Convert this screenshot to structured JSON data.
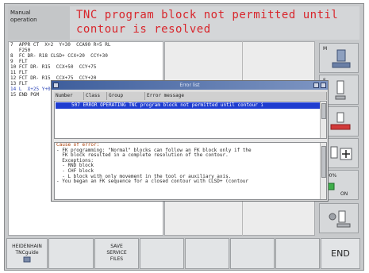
{
  "header": {
    "mode_label": [
      "Manual",
      "operation"
    ],
    "title_lines": [
      "TNC program block not permitted until",
      "contour is resolved"
    ]
  },
  "program": {
    "lines": [
      "7  APPR CT  X+2  Y+30  CCA90 R+5 RL",
      "   F250",
      "8  FC DR- R18 CLSD+ CCX+20  CCY+30",
      "9  FLT",
      "10 FCT DR- R15  CCX+50  CCY+75",
      "11 FLT",
      "12 FCT DR- R15  CCX+75  CCY+20",
      "13 FLT",
      "14 L  X+25 Y+0 R0 FMAX",
      "15 END PGM"
    ],
    "highlighted_index": 8
  },
  "error_dialog": {
    "title": "Error list",
    "columns": [
      "Number",
      "Class",
      "Group",
      "Error message"
    ],
    "selected_row": "507 ERROR OPERATING TNC program block not permitted until contour i",
    "cause_heading": "Cause of error:",
    "cause_lines": [
      "- FK programming: \"Normal\" blocks can follow an FK block only if the",
      "  FK block resulted in a complete resolution of the contour.",
      "  Exceptions:",
      "  - RND block",
      "  - CHF block",
      "  - L block with only movement in the tool or auxiliary axis.",
      "- You began an FK sequence for a closed contour with CLSD+ (contour"
    ]
  },
  "side_keys": [
    {
      "name": "m-function",
      "label": "M"
    },
    {
      "name": "s-function",
      "label": "S"
    },
    {
      "name": "f-function",
      "label": "F"
    },
    {
      "name": "axis-plus",
      "label": ""
    },
    {
      "name": "feed-override",
      "label": "100%"
    },
    {
      "name": "spindle-override",
      "label": ""
    }
  ],
  "feed_override": {
    "value": "100%",
    "state": "ON"
  },
  "soft_keys": [
    {
      "name": "heidenhain-tncguide",
      "line1": "HEIDENHAIN",
      "line2": "TNCguide"
    },
    {
      "name": "save-service-files",
      "line1": "SAVE",
      "line2": "SERVICE",
      "line3": "FILES"
    },
    {
      "name": "end",
      "line1": "END"
    }
  ],
  "colors": {
    "alert_text": "#d8262c",
    "selection": "#1f3dd0",
    "dialog_title": "#3e5e9c",
    "highlight_line": "#3048b8"
  }
}
